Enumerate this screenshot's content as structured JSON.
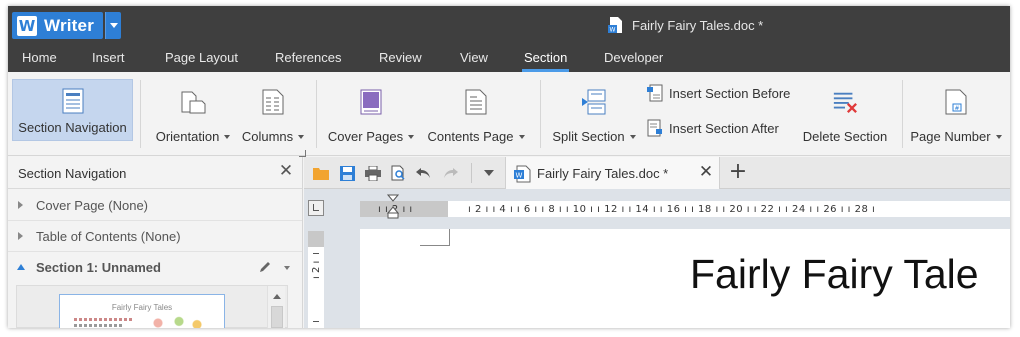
{
  "app": {
    "name": "Writer",
    "logo_letter": "W"
  },
  "window": {
    "title": "Fairly Fairy Tales.doc *"
  },
  "menu": {
    "items": [
      {
        "label": "Home",
        "active": false
      },
      {
        "label": "Insert",
        "active": false
      },
      {
        "label": "Page Layout",
        "active": false
      },
      {
        "label": "References",
        "active": false
      },
      {
        "label": "Review",
        "active": false
      },
      {
        "label": "View",
        "active": false
      },
      {
        "label": "Section",
        "active": true
      },
      {
        "label": "Developer",
        "active": false
      }
    ]
  },
  "ribbon": {
    "section_navigation": "Section Navigation",
    "orientation": "Orientation",
    "columns": "Columns",
    "cover_pages": "Cover Pages",
    "contents_page": "Contents Page",
    "split_section": "Split Section",
    "insert_section_before": "Insert Section Before",
    "insert_section_after": "Insert Section After",
    "delete_section": "Delete Section",
    "page_number": "Page Number"
  },
  "nav_pane": {
    "title": "Section Navigation",
    "items": [
      {
        "label": "Cover Page (None)",
        "expanded": false
      },
      {
        "label": "Table of Contents (None)",
        "expanded": false
      },
      {
        "label": "Section 1: Unnamed",
        "expanded": true
      }
    ],
    "thumbnail_title": "Fairly Fairy Tales"
  },
  "tabs": [
    {
      "label": "Fairly Fairy Tales.doc *"
    }
  ],
  "ruler": {
    "left_ticks": "ı ı 2 ı ı",
    "ticks": "ı 2 ı   ı 4 ı   ı 6 ı   ı 8 ı   ı 10 ı   ı 12 ı   ı 14 ı   ı 16 ı   ı 18 ı   ı 20 ı   ı 22 ı   ı 24 ı   ı 26 ı   ı 28 ı",
    "vertical": "ı 2 ı"
  },
  "document": {
    "heading": "Fairly Fairy Tale"
  },
  "colors": {
    "accent": "#2e7fd6",
    "titlebar": "#3f3f3f",
    "selected": "#c5d6ee",
    "close_red": "#e03a3a"
  }
}
